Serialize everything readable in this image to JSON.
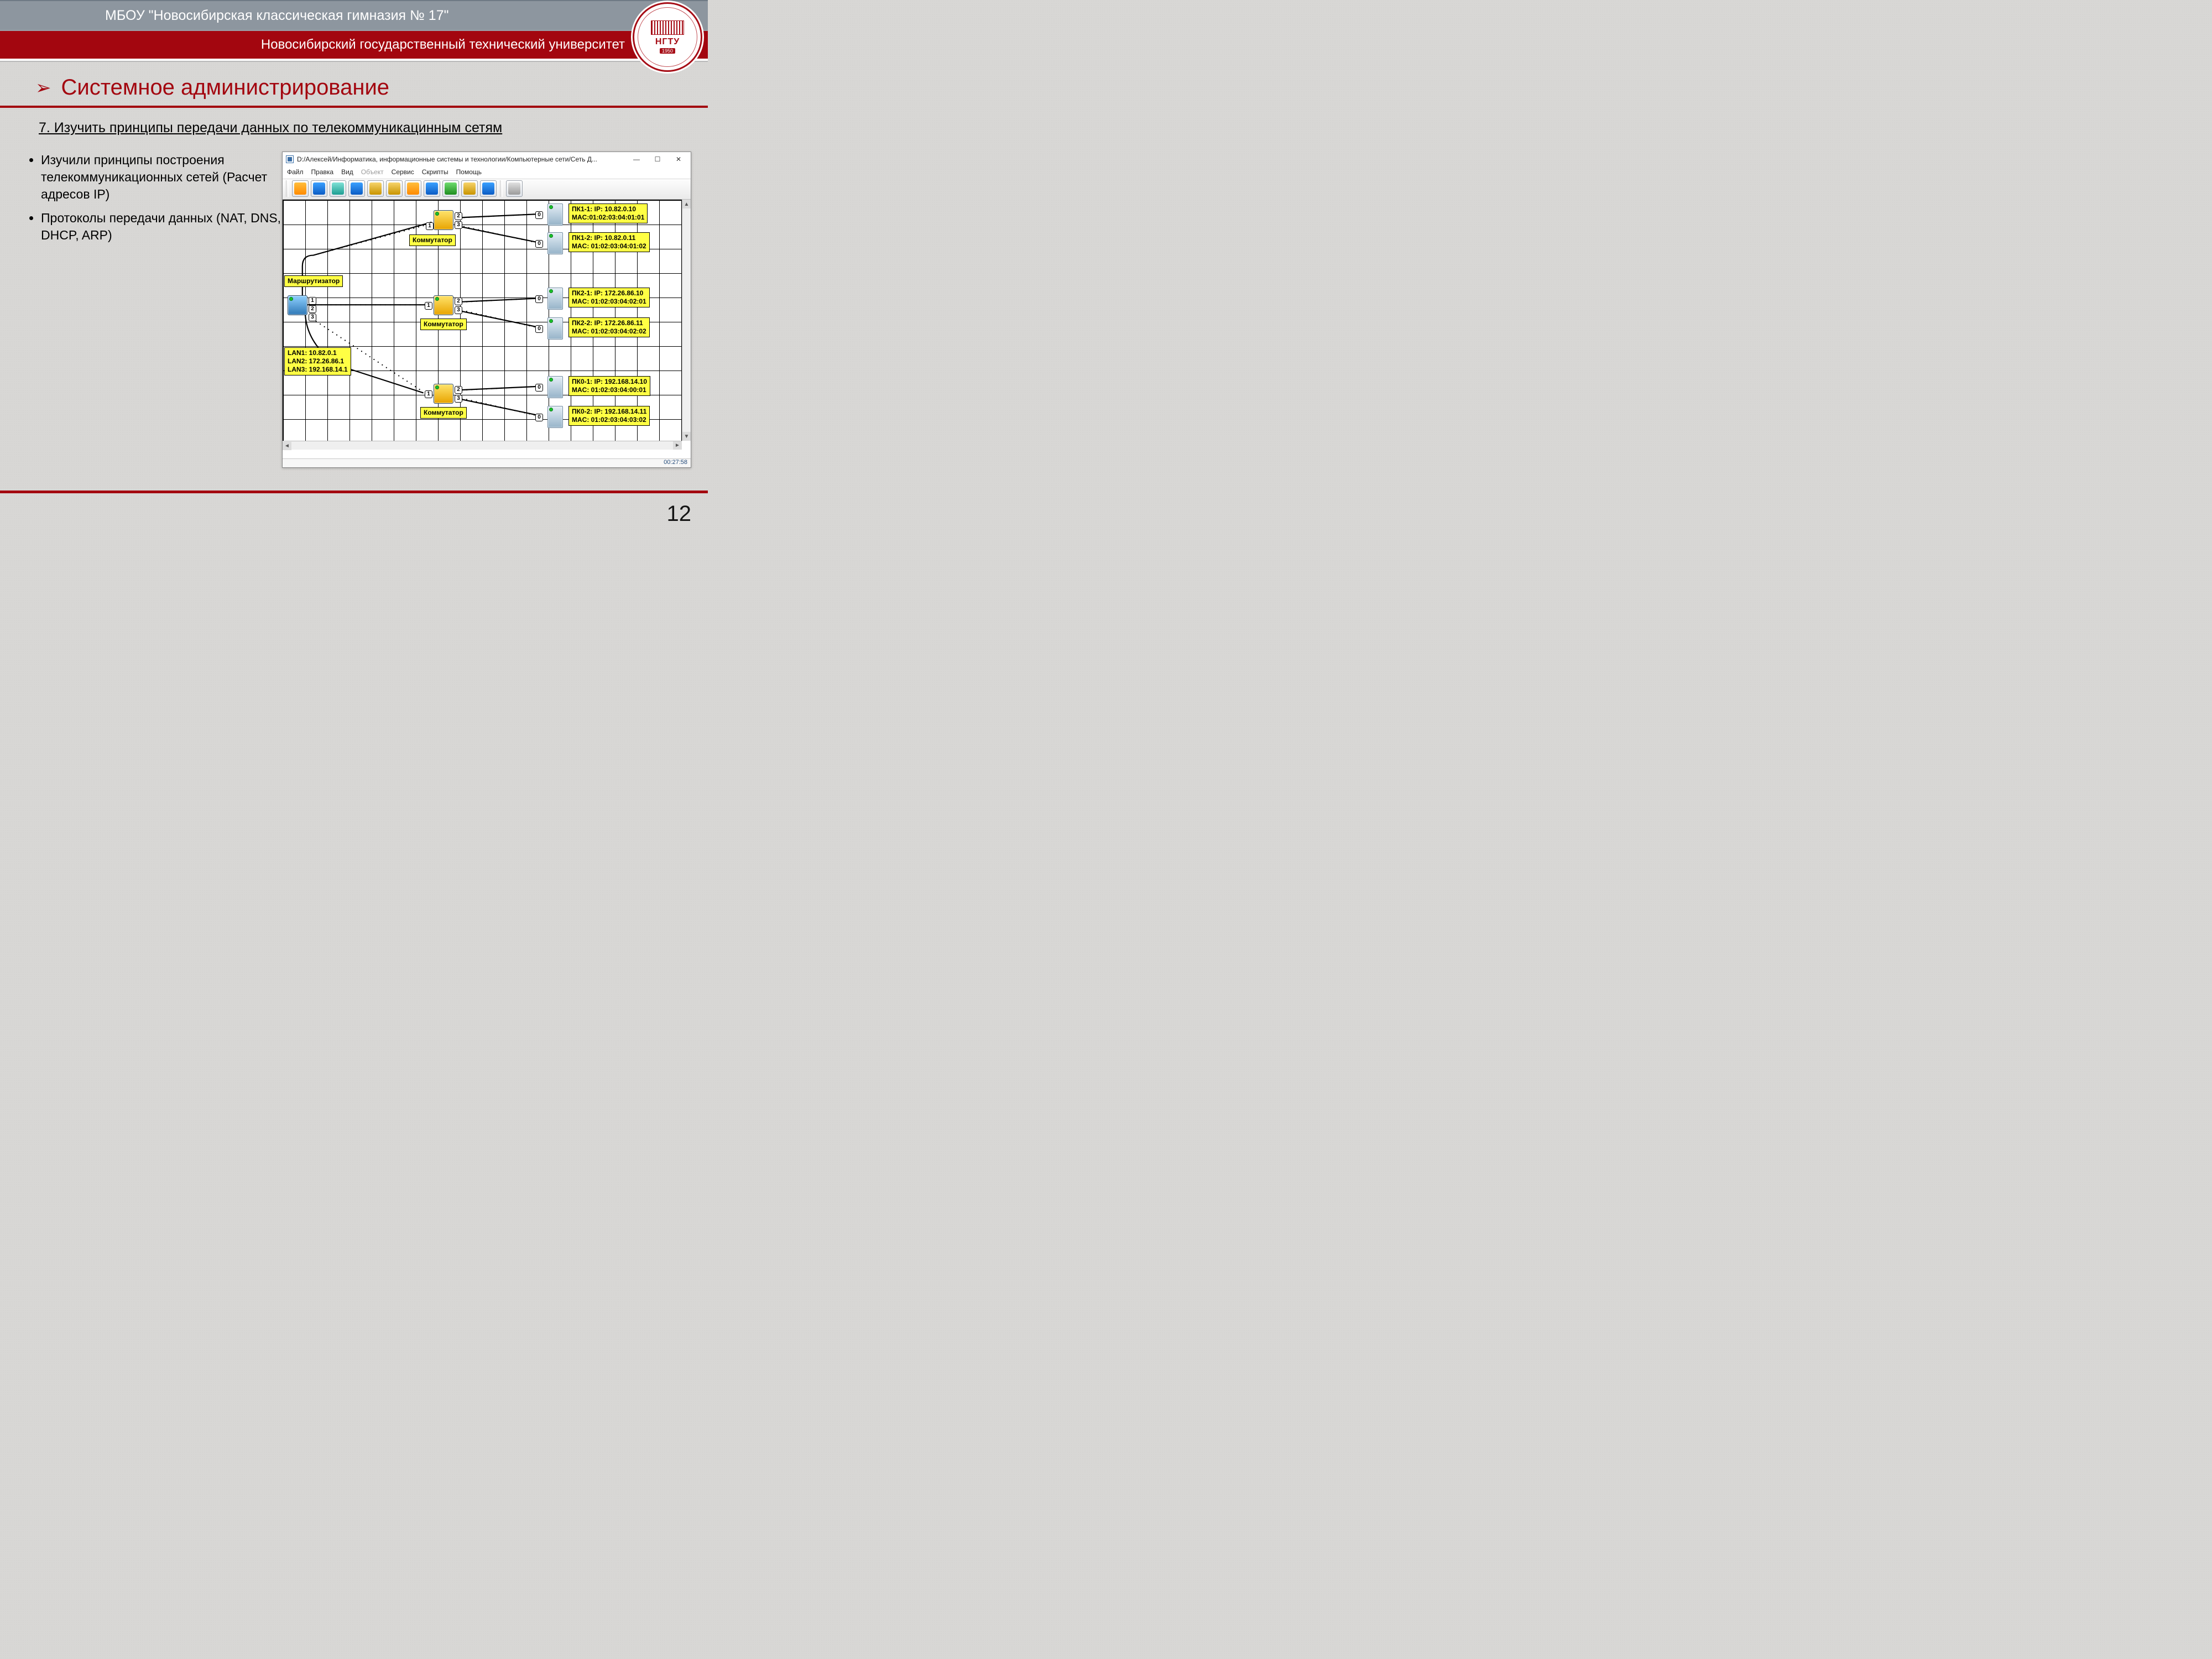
{
  "header": {
    "school": "МБОУ \"Новосибирская классическая гимназия № 17\"",
    "university": "Новосибирский государственный технический университет",
    "logo_abbr": "НГТУ",
    "logo_year": "1950"
  },
  "section_title": "Системное администрирование",
  "subtitle": "7. Изучить принципы передачи данных по телекоммуникацинным сетям",
  "bullets": [
    "Изучили принципы построения телекоммуникационных сетей (Расчет адресов IP)",
    "Протоколы передачи данных (NAT, DNS, DHCP, ARP)"
  ],
  "app": {
    "title": "D:/Алексей/Информатика, информационные системы и технологии/Компьютерные сети/Сеть Д...",
    "menu": [
      "Файл",
      "Правка",
      "Вид",
      "Объект",
      "Сервис",
      "Скрипты",
      "Помощь"
    ],
    "menu_disabled_index": 3,
    "status_time": "00:27:58"
  },
  "network": {
    "router_label": "Маршрутизатор",
    "switch_label": "Коммутатор",
    "lan_box": [
      "LAN1: 10.82.0.1",
      "LAN2: 172.26.86.1",
      "LAN3: 192.168.14.1"
    ],
    "pcs": [
      {
        "ip": "ПК1-1: IP: 10.82.0.10",
        "mac": "MAC:01:02:03:04:01:01"
      },
      {
        "ip": "ПК1-2: IP: 10.82.0.11",
        "mac": "MAC: 01:02:03:04:01:02"
      },
      {
        "ip": "ПК2-1: IP: 172.26.86.10",
        "mac": "MAC: 01:02:03:04:02:01"
      },
      {
        "ip": "ПК2-2: IP: 172.26.86.11",
        "mac": "MAC: 01:02:03:04:02:02"
      },
      {
        "ip": "ПК0-1: IP: 192.168.14.10",
        "mac": "MAC: 01:02:03:04:00:01"
      },
      {
        "ip": "ПК0-2: IP: 192.168.14.11",
        "mac": "MAC: 01:02:03:04:03:02"
      }
    ]
  },
  "page_number": "12"
}
